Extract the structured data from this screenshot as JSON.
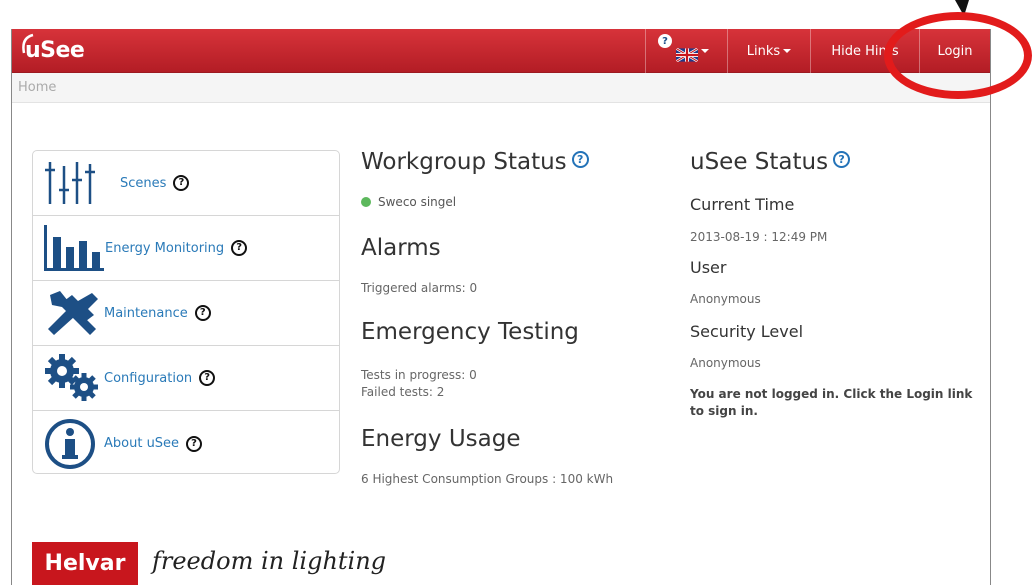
{
  "header": {
    "brand": "uSee",
    "help_badge": "?",
    "nav": {
      "links": "Links",
      "hide_hints": "Hide Hints",
      "login": "Login"
    }
  },
  "breadcrumb": "Home",
  "sidebar": {
    "items": [
      {
        "label": "Scenes",
        "icon": "scenes-sliders-icon"
      },
      {
        "label": "Energy Monitoring",
        "icon": "energy-bar-chart-icon"
      },
      {
        "label": "Maintenance",
        "icon": "maintenance-tools-icon"
      },
      {
        "label": "Configuration",
        "icon": "configuration-gears-icon"
      },
      {
        "label": "About uSee",
        "icon": "about-info-icon"
      }
    ],
    "help": "?"
  },
  "workgroup": {
    "title": "Workgroup Status",
    "group_name": "Sweco singel",
    "group_status_color": "#5cb85c"
  },
  "alarms": {
    "title": "Alarms",
    "triggered": "Triggered alarms: 0"
  },
  "emergency": {
    "title": "Emergency Testing",
    "in_progress": "Tests in progress: 0",
    "failed": "Failed tests: 2"
  },
  "energy": {
    "title": "Energy Usage",
    "consumption": "6 Highest Consumption Groups : 100 kWh"
  },
  "usee_status": {
    "title": "uSee Status",
    "current_time_label": "Current Time",
    "current_time": "2013-08-19 : 12:49 PM",
    "user_label": "User",
    "user": "Anonymous",
    "security_label": "Security Level",
    "security": "Anonymous",
    "login_notice": "You are not logged in. Click the Login link to sign in."
  },
  "footer": {
    "logo": "Helvar",
    "tagline": "freedom in lighting"
  },
  "colors": {
    "brand_red": "#c8161d",
    "link_blue": "#2a7ab8",
    "annotation_red": "#e21b1b"
  }
}
